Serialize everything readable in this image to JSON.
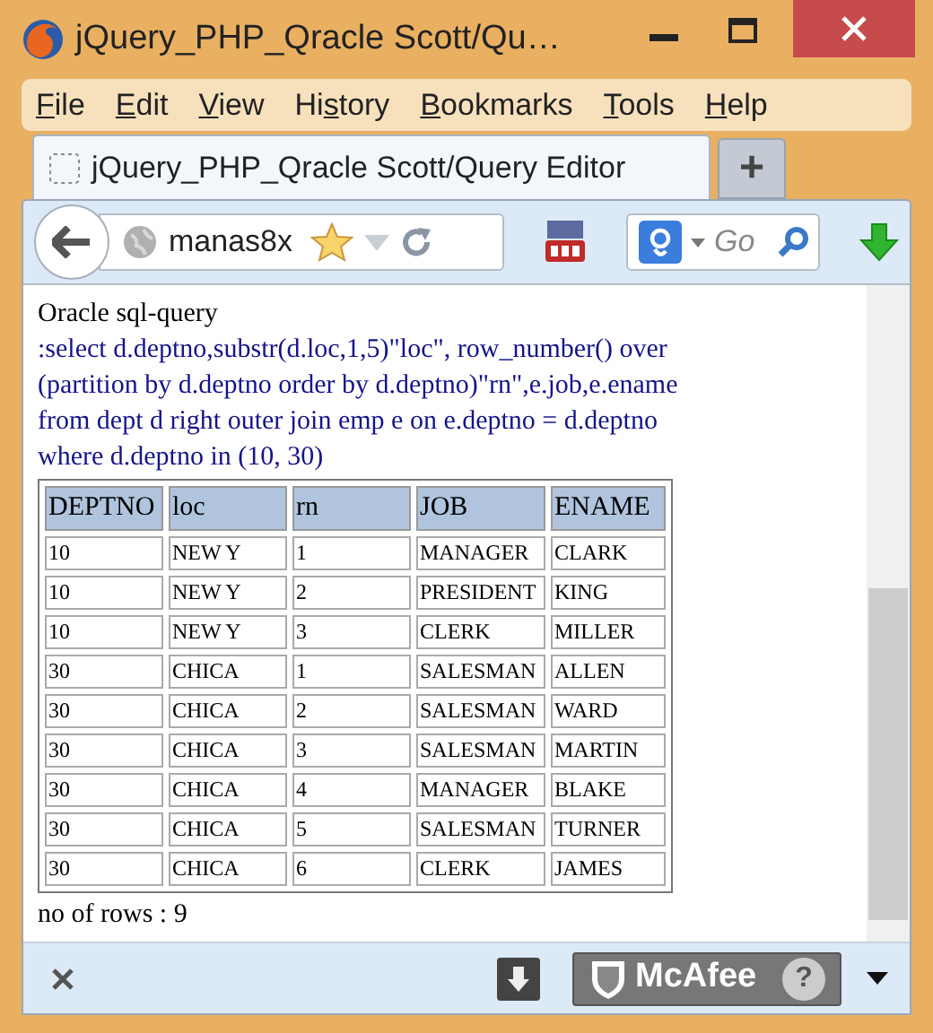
{
  "window": {
    "title": "jQuery_PHP_Qracle Scott/Qu…"
  },
  "menu": [
    {
      "key": "F",
      "post": "ile"
    },
    {
      "key": "E",
      "post": "dit"
    },
    {
      "key": "V",
      "post": "iew"
    },
    {
      "pre": "Hi",
      "key": "s",
      "post": "tory"
    },
    {
      "key": "B",
      "post": "ookmarks"
    },
    {
      "key": "T",
      "post": "ools"
    },
    {
      "key": "H",
      "post": "elp"
    }
  ],
  "tabs": [
    {
      "label": "jQuery_PHP_Qracle Scott/Query Editor",
      "selected": true
    }
  ],
  "new_tab": "+",
  "address": {
    "value": "manas8x"
  },
  "search": {
    "placeholder": "Go"
  },
  "page": {
    "heading": "Oracle sql-query",
    "query_lines": [
      ":select d.deptno,substr(d.loc,1,5)\"loc\", row_number() over",
      "(partition by d.deptno order by d.deptno)\"rn\",e.job,e.ename",
      "from dept d right outer join emp e on e.deptno = d.deptno",
      "where d.deptno in (10, 30)"
    ],
    "table": {
      "columns": [
        "DEPTNO",
        "loc",
        "rn",
        "JOB",
        "ENAME"
      ],
      "rows": [
        [
          "10",
          "NEW Y",
          "1",
          "MANAGER",
          "CLARK"
        ],
        [
          "10",
          "NEW Y",
          "2",
          "PRESIDENT",
          "KING"
        ],
        [
          "10",
          "NEW Y",
          "3",
          "CLERK",
          "MILLER"
        ],
        [
          "30",
          "CHICA",
          "1",
          "SALESMAN",
          "ALLEN"
        ],
        [
          "30",
          "CHICA",
          "2",
          "SALESMAN",
          "WARD"
        ],
        [
          "30",
          "CHICA",
          "3",
          "SALESMAN",
          "MARTIN"
        ],
        [
          "30",
          "CHICA",
          "4",
          "MANAGER",
          "BLAKE"
        ],
        [
          "30",
          "CHICA",
          "5",
          "SALESMAN",
          "TURNER"
        ],
        [
          "30",
          "CHICA",
          "6",
          "CLERK",
          "JAMES"
        ]
      ]
    },
    "footer": "no of rows : 9"
  },
  "addon_bar": {
    "badge": "McAfee",
    "help": "?"
  }
}
